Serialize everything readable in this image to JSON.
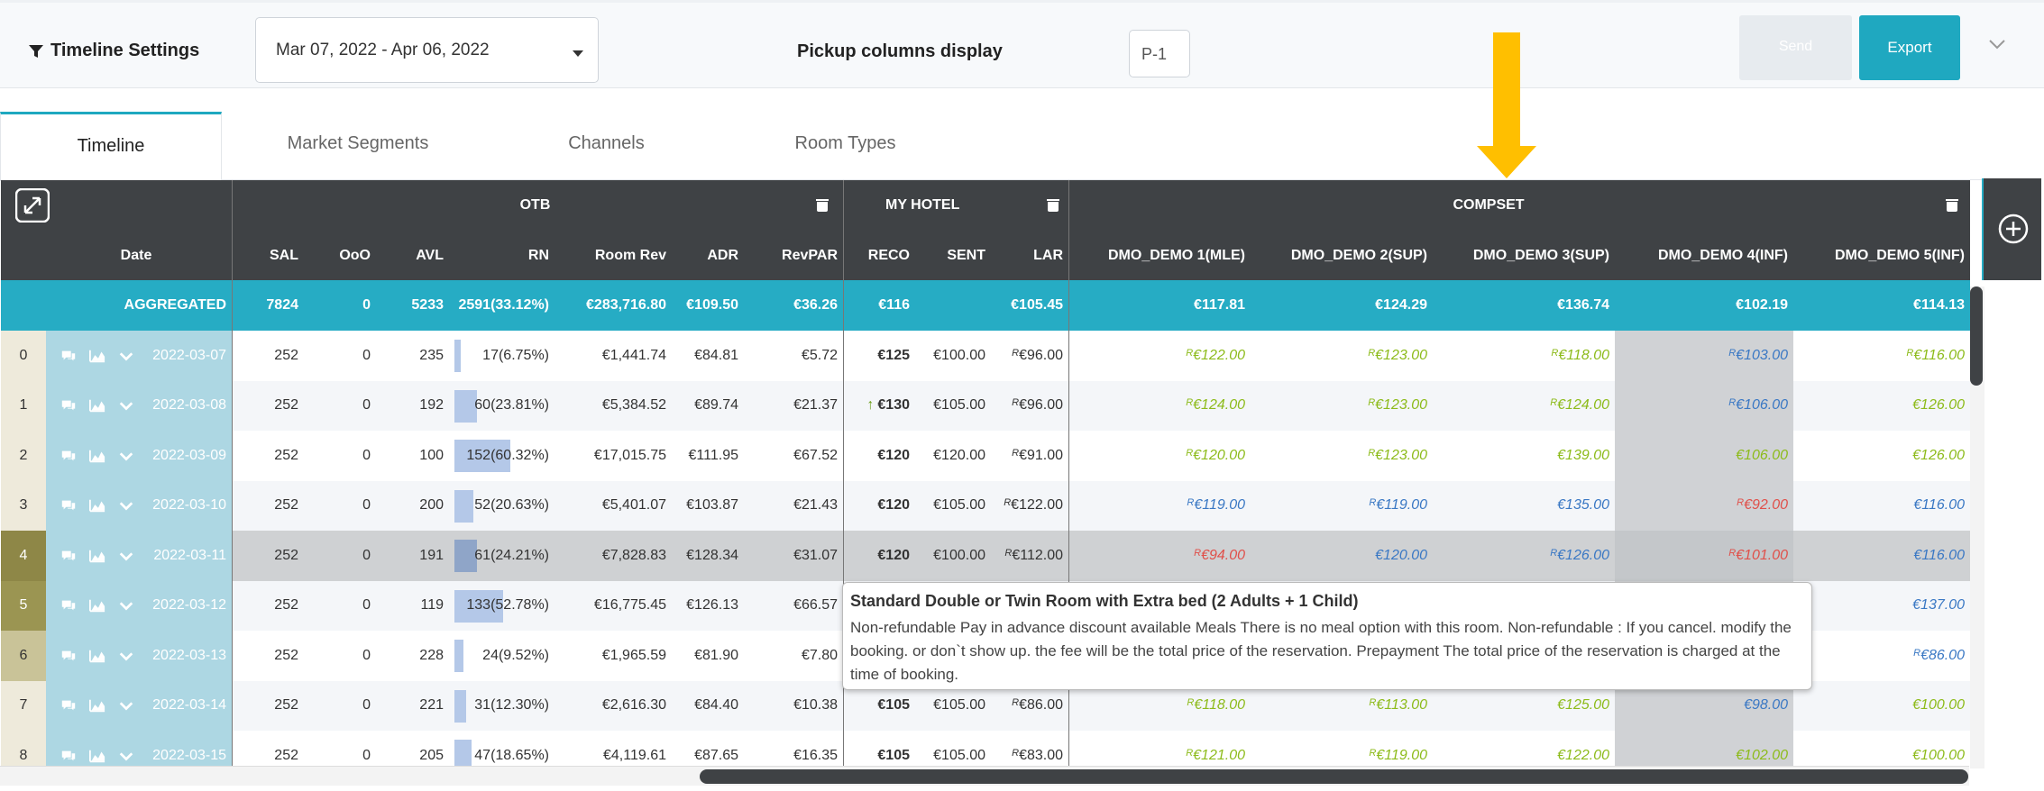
{
  "topbar": {
    "title": "Timeline Settings",
    "date_range": "Mar 07, 2022 - Apr 06, 2022",
    "pickup_label": "Pickup columns display",
    "pickup_value": "P-1",
    "send_label": "Send",
    "export_label": "Export"
  },
  "tabs": [
    "Timeline",
    "Market Segments",
    "Channels",
    "Room Types"
  ],
  "groups": {
    "otb": "OTB",
    "my_hotel": "MY HOTEL",
    "compset": "COMPSET"
  },
  "columns": {
    "date": "Date",
    "sal": "SAL",
    "ooo": "OoO",
    "avl": "AVL",
    "rn": "RN",
    "room_rev": "Room Rev",
    "adr": "ADR",
    "revpar": "RevPAR",
    "reco": "RECO",
    "sent": "SENT",
    "lar": "LAR",
    "c1": "DMO_DEMO 1(MLE)",
    "c2": "DMO_DEMO 2(SUP)",
    "c3": "DMO_DEMO 3(SUP)",
    "c4": "DMO_DEMO 4(INF)",
    "c5": "DMO_DEMO 5(INF)"
  },
  "aggregated": {
    "label": "AGGREGATED",
    "sal": "7824",
    "ooo": "0",
    "avl": "5233",
    "rn": "2591(33.12%)",
    "room_rev": "€283,716.80",
    "adr": "€109.50",
    "revpar": "€36.26",
    "reco": "€116",
    "sent": "",
    "lar": "€105.45",
    "c1": "€117.81",
    "c2": "€124.29",
    "c3": "€136.74",
    "c4": "€102.19",
    "c5": "€114.13"
  },
  "rows": [
    {
      "idx": "0",
      "date": "2022-03-07",
      "sal": "252",
      "ooo": "0",
      "avl": "235",
      "rn": "17(6.75%)",
      "rn_pct": 6.75,
      "room_rev": "€1,441.74",
      "adr": "€84.81",
      "revpar": "€5.72",
      "reco": "€125",
      "reco_up": "",
      "sent": "€100.00",
      "lar_r": "R",
      "lar": "€96.00",
      "c1_r": "R",
      "c1": "€122.00",
      "c1_color": "green",
      "c2_r": "R",
      "c2": "€123.00",
      "c2_color": "green",
      "c3_r": "R",
      "c3": "€118.00",
      "c3_color": "green",
      "c4_r": "R",
      "c4": "€103.00",
      "c4_color": "blue",
      "c5_r": "R",
      "c5": "€116.00",
      "c5_color": "green",
      "shade": "#eeeadb"
    },
    {
      "idx": "1",
      "date": "2022-03-08",
      "sal": "252",
      "ooo": "0",
      "avl": "192",
      "rn": "60(23.81%)",
      "rn_pct": 23.81,
      "room_rev": "€5,384.52",
      "adr": "€89.74",
      "revpar": "€21.37",
      "reco": "€130",
      "reco_up": "↑",
      "sent": "€105.00",
      "lar_r": "R",
      "lar": "€96.00",
      "c1_r": "R",
      "c1": "€124.00",
      "c1_color": "green",
      "c2_r": "R",
      "c2": "€123.00",
      "c2_color": "green",
      "c3_r": "R",
      "c3": "€124.00",
      "c3_color": "green",
      "c4_r": "R",
      "c4": "€106.00",
      "c4_color": "blue",
      "c5_r": "",
      "c5": "€126.00",
      "c5_color": "green",
      "shade": "#eeeadb"
    },
    {
      "idx": "2",
      "date": "2022-03-09",
      "sal": "252",
      "ooo": "0",
      "avl": "100",
      "rn": "152(60.32%)",
      "rn_pct": 60.32,
      "room_rev": "€17,015.75",
      "adr": "€111.95",
      "revpar": "€67.52",
      "reco": "€120",
      "reco_up": "",
      "sent": "€120.00",
      "lar_r": "R",
      "lar": "€91.00",
      "c1_r": "R",
      "c1": "€120.00",
      "c1_color": "green",
      "c2_r": "R",
      "c2": "€123.00",
      "c2_color": "green",
      "c3_r": "",
      "c3": "€139.00",
      "c3_color": "green",
      "c4_r": "",
      "c4": "€106.00",
      "c4_color": "green",
      "c5_r": "",
      "c5": "€126.00",
      "c5_color": "green",
      "shade": "#eeeadb"
    },
    {
      "idx": "3",
      "date": "2022-03-10",
      "sal": "252",
      "ooo": "0",
      "avl": "200",
      "rn": "52(20.63%)",
      "rn_pct": 20.63,
      "room_rev": "€5,401.07",
      "adr": "€103.87",
      "revpar": "€21.43",
      "reco": "€120",
      "reco_up": "",
      "sent": "€105.00",
      "lar_r": "R",
      "lar": "€122.00",
      "c1_r": "R",
      "c1": "€119.00",
      "c1_color": "blue",
      "c2_r": "R",
      "c2": "€119.00",
      "c2_color": "blue",
      "c3_r": "",
      "c3": "€135.00",
      "c3_color": "blue",
      "c4_r": "R",
      "c4": "€92.00",
      "c4_color": "red",
      "c5_r": "",
      "c5": "€116.00",
      "c5_color": "blue",
      "shade": "#eeeadb"
    },
    {
      "idx": "4",
      "date": "2022-03-11",
      "sal": "252",
      "ooo": "0",
      "avl": "191",
      "rn": "61(24.21%)",
      "rn_pct": 24.21,
      "room_rev": "€7,828.83",
      "adr": "€128.34",
      "revpar": "€31.07",
      "reco": "€120",
      "reco_up": "",
      "sent": "€100.00",
      "lar_r": "R",
      "lar": "€112.00",
      "c1_r": "R",
      "c1": "€94.00",
      "c1_color": "red",
      "c2_r": "",
      "c2": "€120.00",
      "c2_color": "blue",
      "c3_r": "R",
      "c3": "€126.00",
      "c3_color": "blue",
      "c4_r": "R",
      "c4": "€101.00",
      "c4_color": "red",
      "c5_r": "",
      "c5": "€116.00",
      "c5_color": "blue",
      "shade": "#8e8747"
    },
    {
      "idx": "5",
      "date": "2022-03-12",
      "sal": "252",
      "ooo": "0",
      "avl": "119",
      "rn": "133(52.78%)",
      "rn_pct": 52.78,
      "room_rev": "€16,775.45",
      "adr": "€126.13",
      "revpar": "€66.57",
      "reco": "",
      "reco_up": "",
      "sent": "",
      "lar_r": "",
      "lar": "",
      "c1_r": "",
      "c1": "",
      "c1_color": "blue",
      "c2_r": "",
      "c2": "",
      "c2_color": "blue",
      "c3_r": "",
      "c3": "",
      "c3_color": "blue",
      "c4_r": "",
      "c4": "",
      "c4_color": "blue",
      "c5_r": "",
      "c5": "€137.00",
      "c5_color": "blue",
      "shade": "#9b9552"
    },
    {
      "idx": "6",
      "date": "2022-03-13",
      "sal": "252",
      "ooo": "0",
      "avl": "228",
      "rn": "24(9.52%)",
      "rn_pct": 9.52,
      "room_rev": "€1,965.59",
      "adr": "€81.90",
      "revpar": "€7.80",
      "reco": "",
      "reco_up": "",
      "sent": "",
      "lar_r": "",
      "lar": "",
      "c1_r": "",
      "c1": "",
      "c1_color": "blue",
      "c2_r": "",
      "c2": "",
      "c2_color": "blue",
      "c3_r": "",
      "c3": "",
      "c3_color": "blue",
      "c4_r": "",
      "c4": "",
      "c4_color": "blue",
      "c5_r": "R",
      "c5": "€86.00",
      "c5_color": "blue",
      "shade": "#c9c398"
    },
    {
      "idx": "7",
      "date": "2022-03-14",
      "sal": "252",
      "ooo": "0",
      "avl": "221",
      "rn": "31(12.30%)",
      "rn_pct": 12.3,
      "room_rev": "€2,616.30",
      "adr": "€84.40",
      "revpar": "€10.38",
      "reco": "€105",
      "reco_up": "",
      "sent": "€105.00",
      "lar_r": "R",
      "lar": "€86.00",
      "c1_r": "R",
      "c1": "€118.00",
      "c1_color": "green",
      "c2_r": "R",
      "c2": "€113.00",
      "c2_color": "green",
      "c3_r": "",
      "c3": "€125.00",
      "c3_color": "green",
      "c4_r": "",
      "c4": "€98.00",
      "c4_color": "blue",
      "c5_r": "",
      "c5": "€100.00",
      "c5_color": "green",
      "shade": "#eeeadb"
    },
    {
      "idx": "8",
      "date": "2022-03-15",
      "sal": "252",
      "ooo": "0",
      "avl": "205",
      "rn": "47(18.65%)",
      "rn_pct": 18.65,
      "room_rev": "€4,119.61",
      "adr": "€87.65",
      "revpar": "€16.35",
      "reco": "€105",
      "reco_up": "",
      "sent": "€105.00",
      "lar_r": "R",
      "lar": "€83.00",
      "c1_r": "R",
      "c1": "€121.00",
      "c1_color": "green",
      "c2_r": "R",
      "c2": "€119.00",
      "c2_color": "green",
      "c3_r": "",
      "c3": "€122.00",
      "c3_color": "green",
      "c4_r": "",
      "c4": "€102.00",
      "c4_color": "green",
      "c5_r": "",
      "c5": "€100.00",
      "c5_color": "green",
      "shade": "#eeeadb"
    }
  ],
  "tooltip": {
    "title": "Standard Double or Twin Room with Extra bed (2 Adults + 1 Child)",
    "body": "Non-refundable Pay in advance discount available Meals There is no meal option with this room. Non-refundable : If you cancel. modify the booking. or don`t show up. the fee will be the total price of the reservation. Prepayment The total price of the reservation is charged at the time of booking."
  },
  "colors": {
    "accent": "#26acc4",
    "header": "#3f4245",
    "green": "#8dbb1b",
    "blue": "#3a78c4",
    "red": "#e0504a",
    "arrow": "#ffbf00"
  },
  "icons": [
    "filter-icon",
    "expand-icon",
    "trash-icon",
    "comment-icon",
    "chart-icon",
    "chevron-down-icon",
    "plus-circle-icon",
    "arrow-down-annotation"
  ]
}
